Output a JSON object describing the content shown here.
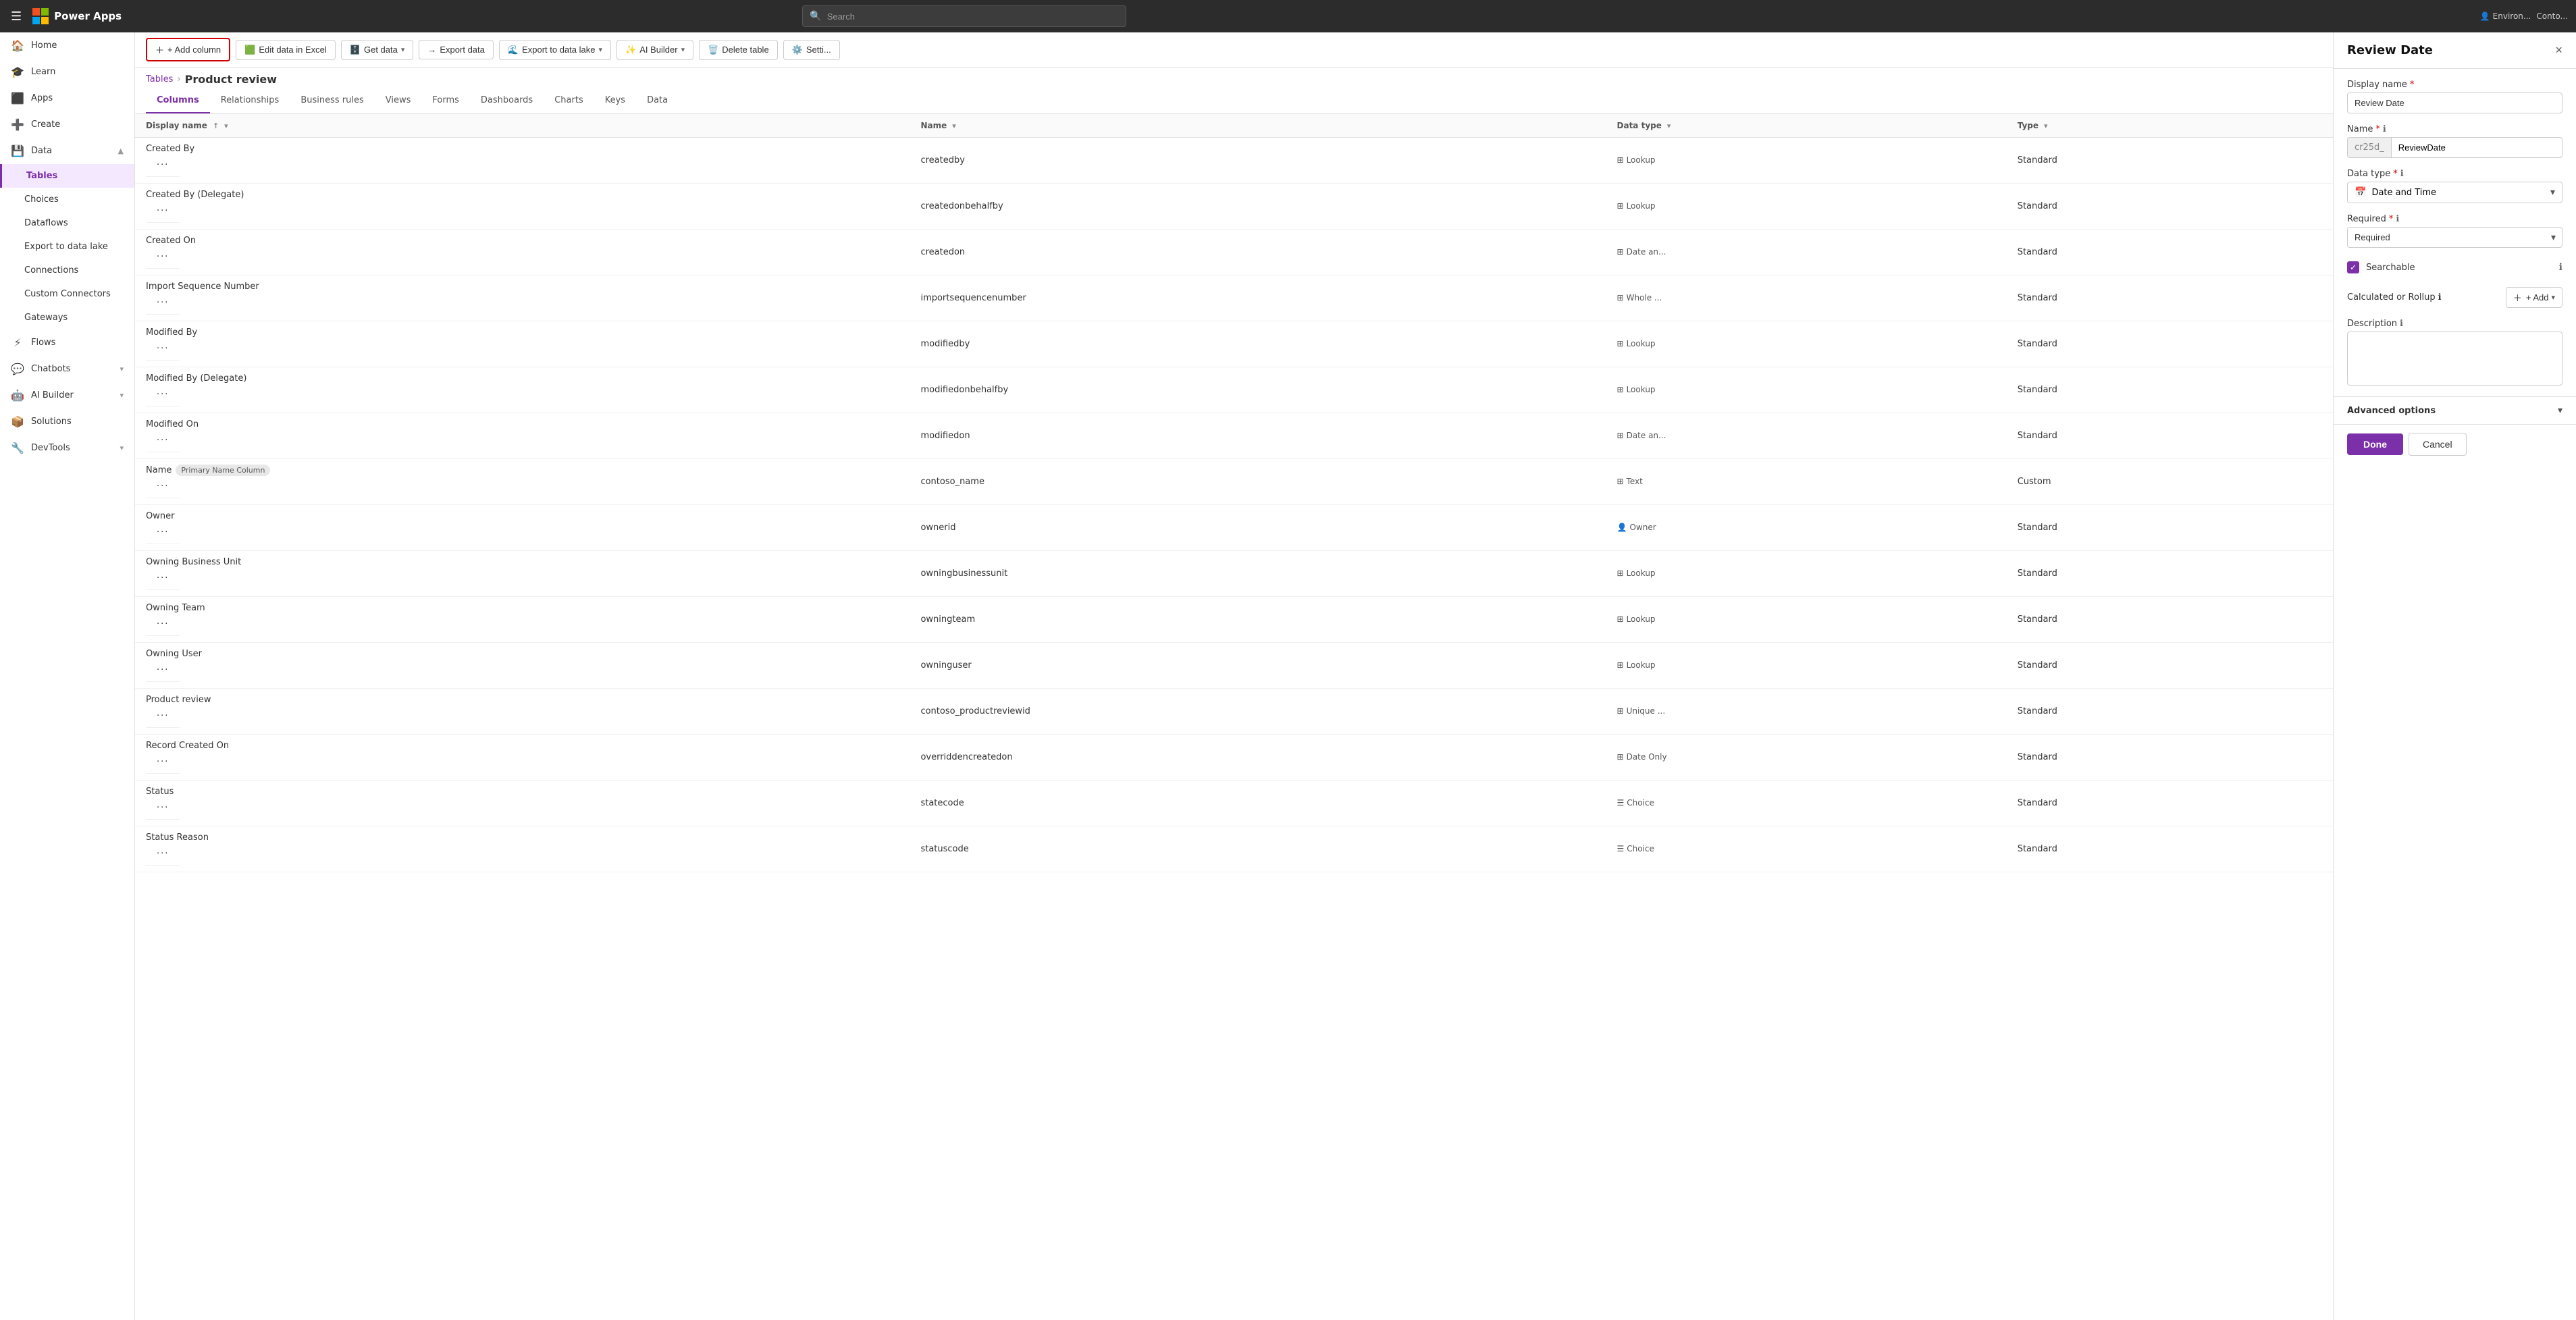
{
  "topnav": {
    "appname": "Power Apps",
    "search_placeholder": "Search",
    "env_label": "Environ...",
    "env_sub": "Conto..."
  },
  "sidebar": {
    "items": [
      {
        "id": "home",
        "label": "Home",
        "icon": "🏠"
      },
      {
        "id": "learn",
        "label": "Learn",
        "icon": "🎓"
      },
      {
        "id": "apps",
        "label": "Apps",
        "icon": "⬛"
      },
      {
        "id": "create",
        "label": "Create",
        "icon": "➕"
      },
      {
        "id": "data",
        "label": "Data",
        "icon": "💾",
        "expanded": true
      },
      {
        "id": "tables",
        "label": "Tables",
        "icon": "",
        "active": true,
        "sub": true
      },
      {
        "id": "choices",
        "label": "Choices",
        "icon": "",
        "sub": true
      },
      {
        "id": "dataflows",
        "label": "Dataflows",
        "icon": "",
        "sub": true
      },
      {
        "id": "export",
        "label": "Export to data lake",
        "icon": "",
        "sub": true
      },
      {
        "id": "connections",
        "label": "Connections",
        "icon": "",
        "sub": true
      },
      {
        "id": "custom-connectors",
        "label": "Custom Connectors",
        "icon": "",
        "sub": true
      },
      {
        "id": "gateways",
        "label": "Gateways",
        "icon": "",
        "sub": true
      },
      {
        "id": "flows",
        "label": "Flows",
        "icon": "⚡"
      },
      {
        "id": "chatbots",
        "label": "Chatbots",
        "icon": "💬",
        "expand": "▾"
      },
      {
        "id": "ai-builder",
        "label": "AI Builder",
        "icon": "🤖",
        "expand": "▾"
      },
      {
        "id": "solutions",
        "label": "Solutions",
        "icon": "📦"
      },
      {
        "id": "devtools",
        "label": "DevTools",
        "icon": "🔧",
        "expand": "▾"
      }
    ]
  },
  "toolbar": {
    "add_column": "+ Add column",
    "edit_excel": "Edit data in Excel",
    "get_data": "Get data",
    "export_data": "Export data",
    "export_lake": "Export to data lake",
    "ai_builder": "AI Builder",
    "delete_table": "Delete table",
    "settings": "Setti..."
  },
  "breadcrumb": {
    "parent": "Tables",
    "current": "Product review"
  },
  "tabs": [
    {
      "id": "columns",
      "label": "Columns",
      "active": true
    },
    {
      "id": "relationships",
      "label": "Relationships"
    },
    {
      "id": "business-rules",
      "label": "Business rules"
    },
    {
      "id": "views",
      "label": "Views"
    },
    {
      "id": "forms",
      "label": "Forms"
    },
    {
      "id": "dashboards",
      "label": "Dashboards"
    },
    {
      "id": "charts",
      "label": "Charts"
    },
    {
      "id": "keys",
      "label": "Keys"
    },
    {
      "id": "data",
      "label": "Data"
    }
  ],
  "table": {
    "col_display_name": "Display name",
    "col_name": "Name",
    "col_data_type": "Data type",
    "col_type": "Type",
    "rows": [
      {
        "display_name": "Created By",
        "name": "createdby",
        "data_type": "Lookup",
        "type": "Standard",
        "icon": "⊞"
      },
      {
        "display_name": "Created By (Delegate)",
        "name": "createdonbehalfby",
        "data_type": "Lookup",
        "type": "Standard",
        "icon": "⊞"
      },
      {
        "display_name": "Created On",
        "name": "createdon",
        "data_type": "Date an...",
        "type": "Standard",
        "icon": "⊞"
      },
      {
        "display_name": "Import Sequence Number",
        "name": "importsequencenumber",
        "data_type": "Whole ...",
        "type": "Standard",
        "icon": "⊞"
      },
      {
        "display_name": "Modified By",
        "name": "modifiedby",
        "data_type": "Lookup",
        "type": "Standard",
        "icon": "⊞"
      },
      {
        "display_name": "Modified By (Delegate)",
        "name": "modifiedonbehalfby",
        "data_type": "Lookup",
        "type": "Standard",
        "icon": "⊞"
      },
      {
        "display_name": "Modified On",
        "name": "modifiedon",
        "data_type": "Date an...",
        "type": "Standard",
        "icon": "⊞"
      },
      {
        "display_name": "Name",
        "name": "contoso_name",
        "primary_badge": "Primary Name Column",
        "data_type": "Text",
        "type": "Custom",
        "icon": "⊞"
      },
      {
        "display_name": "Owner",
        "name": "ownerid",
        "data_type": "Owner",
        "type": "Standard",
        "icon": "👤"
      },
      {
        "display_name": "Owning Business Unit",
        "name": "owningbusinessunit",
        "data_type": "Lookup",
        "type": "Standard",
        "icon": "⊞"
      },
      {
        "display_name": "Owning Team",
        "name": "owningteam",
        "data_type": "Lookup",
        "type": "Standard",
        "icon": "⊞"
      },
      {
        "display_name": "Owning User",
        "name": "owninguser",
        "data_type": "Lookup",
        "type": "Standard",
        "icon": "⊞"
      },
      {
        "display_name": "Product review",
        "name": "contoso_productreviewid",
        "data_type": "Unique ...",
        "type": "Standard",
        "icon": "⊞"
      },
      {
        "display_name": "Record Created On",
        "name": "overriddencreatedon",
        "data_type": "Date Only",
        "type": "Standard",
        "icon": "⊞"
      },
      {
        "display_name": "Status",
        "name": "statecode",
        "data_type": "Choice",
        "type": "Standard",
        "icon": "☰"
      },
      {
        "display_name": "Status Reason",
        "name": "statuscode",
        "data_type": "Choice",
        "type": "Standard",
        "icon": "☰"
      }
    ]
  },
  "panel": {
    "title": "Review Date",
    "close_label": "×",
    "display_name_label": "Display name",
    "display_name_value": "Review Date",
    "name_label": "Name",
    "name_prefix": "cr25d_",
    "name_value": "ReviewDate",
    "data_type_label": "Data type",
    "data_type_icon": "📅",
    "data_type_value": "Date and Time",
    "required_label": "Required",
    "required_value": "Required",
    "searchable_label": "Searchable",
    "searchable_checked": true,
    "calc_label": "Calculated or Rollup",
    "calc_add": "+ Add",
    "description_label": "Description",
    "description_placeholder": "",
    "advanced_label": "Advanced options",
    "done_label": "Done",
    "cancel_label": "Cancel"
  }
}
